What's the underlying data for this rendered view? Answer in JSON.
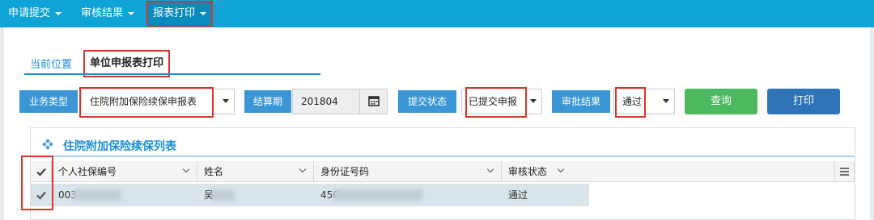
{
  "nav": {
    "items": [
      "申请提交",
      "审核结果",
      "报表打印"
    ],
    "active": "报表打印"
  },
  "breadcrumb": {
    "label": "当前位置",
    "current": "单位申报表打印"
  },
  "filters": {
    "business_type": {
      "label": "业务类型",
      "value": "住院附加保险续保申报表"
    },
    "settlement_period": {
      "label": "结算期",
      "value": "201804"
    },
    "submit_status": {
      "label": "提交状态",
      "value": "已提交申报"
    },
    "approval_result": {
      "label": "审批结果",
      "value": "通过"
    }
  },
  "buttons": {
    "query": "查询",
    "print": "打印"
  },
  "section": {
    "title": "住院附加保险续保列表"
  },
  "table": {
    "columns": [
      "个人社保编号",
      "姓名",
      "身份证号码",
      "审核状态"
    ],
    "rows": [
      {
        "ssn_prefix": "003",
        "name_prefix": "吴",
        "id_prefix": "450",
        "status": "通过"
      }
    ]
  },
  "colors": {
    "nav": "#0fa3d6",
    "label_bg": "#3a96d4",
    "query_btn": "#4cb860",
    "print_btn": "#2f74b7",
    "highlight": "#d9342b"
  }
}
